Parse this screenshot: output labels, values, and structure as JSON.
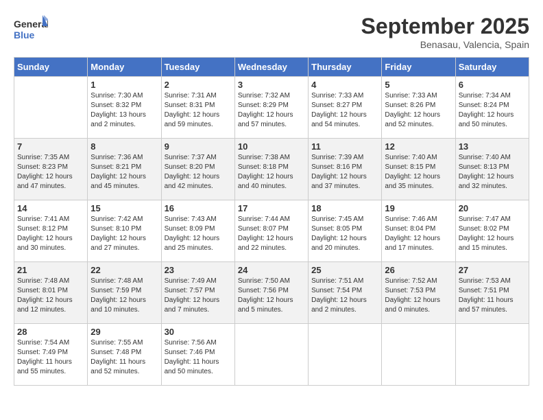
{
  "logo": {
    "text_general": "General",
    "text_blue": "Blue"
  },
  "header": {
    "month": "September 2025",
    "location": "Benasau, Valencia, Spain"
  },
  "weekdays": [
    "Sunday",
    "Monday",
    "Tuesday",
    "Wednesday",
    "Thursday",
    "Friday",
    "Saturday"
  ],
  "weeks": [
    [
      {
        "day": "",
        "info": ""
      },
      {
        "day": "1",
        "info": "Sunrise: 7:30 AM\nSunset: 8:32 PM\nDaylight: 13 hours\nand 2 minutes."
      },
      {
        "day": "2",
        "info": "Sunrise: 7:31 AM\nSunset: 8:31 PM\nDaylight: 12 hours\nand 59 minutes."
      },
      {
        "day": "3",
        "info": "Sunrise: 7:32 AM\nSunset: 8:29 PM\nDaylight: 12 hours\nand 57 minutes."
      },
      {
        "day": "4",
        "info": "Sunrise: 7:33 AM\nSunset: 8:27 PM\nDaylight: 12 hours\nand 54 minutes."
      },
      {
        "day": "5",
        "info": "Sunrise: 7:33 AM\nSunset: 8:26 PM\nDaylight: 12 hours\nand 52 minutes."
      },
      {
        "day": "6",
        "info": "Sunrise: 7:34 AM\nSunset: 8:24 PM\nDaylight: 12 hours\nand 50 minutes."
      }
    ],
    [
      {
        "day": "7",
        "info": "Sunrise: 7:35 AM\nSunset: 8:23 PM\nDaylight: 12 hours\nand 47 minutes."
      },
      {
        "day": "8",
        "info": "Sunrise: 7:36 AM\nSunset: 8:21 PM\nDaylight: 12 hours\nand 45 minutes."
      },
      {
        "day": "9",
        "info": "Sunrise: 7:37 AM\nSunset: 8:20 PM\nDaylight: 12 hours\nand 42 minutes."
      },
      {
        "day": "10",
        "info": "Sunrise: 7:38 AM\nSunset: 8:18 PM\nDaylight: 12 hours\nand 40 minutes."
      },
      {
        "day": "11",
        "info": "Sunrise: 7:39 AM\nSunset: 8:16 PM\nDaylight: 12 hours\nand 37 minutes."
      },
      {
        "day": "12",
        "info": "Sunrise: 7:40 AM\nSunset: 8:15 PM\nDaylight: 12 hours\nand 35 minutes."
      },
      {
        "day": "13",
        "info": "Sunrise: 7:40 AM\nSunset: 8:13 PM\nDaylight: 12 hours\nand 32 minutes."
      }
    ],
    [
      {
        "day": "14",
        "info": "Sunrise: 7:41 AM\nSunset: 8:12 PM\nDaylight: 12 hours\nand 30 minutes."
      },
      {
        "day": "15",
        "info": "Sunrise: 7:42 AM\nSunset: 8:10 PM\nDaylight: 12 hours\nand 27 minutes."
      },
      {
        "day": "16",
        "info": "Sunrise: 7:43 AM\nSunset: 8:09 PM\nDaylight: 12 hours\nand 25 minutes."
      },
      {
        "day": "17",
        "info": "Sunrise: 7:44 AM\nSunset: 8:07 PM\nDaylight: 12 hours\nand 22 minutes."
      },
      {
        "day": "18",
        "info": "Sunrise: 7:45 AM\nSunset: 8:05 PM\nDaylight: 12 hours\nand 20 minutes."
      },
      {
        "day": "19",
        "info": "Sunrise: 7:46 AM\nSunset: 8:04 PM\nDaylight: 12 hours\nand 17 minutes."
      },
      {
        "day": "20",
        "info": "Sunrise: 7:47 AM\nSunset: 8:02 PM\nDaylight: 12 hours\nand 15 minutes."
      }
    ],
    [
      {
        "day": "21",
        "info": "Sunrise: 7:48 AM\nSunset: 8:01 PM\nDaylight: 12 hours\nand 12 minutes."
      },
      {
        "day": "22",
        "info": "Sunrise: 7:48 AM\nSunset: 7:59 PM\nDaylight: 12 hours\nand 10 minutes."
      },
      {
        "day": "23",
        "info": "Sunrise: 7:49 AM\nSunset: 7:57 PM\nDaylight: 12 hours\nand 7 minutes."
      },
      {
        "day": "24",
        "info": "Sunrise: 7:50 AM\nSunset: 7:56 PM\nDaylight: 12 hours\nand 5 minutes."
      },
      {
        "day": "25",
        "info": "Sunrise: 7:51 AM\nSunset: 7:54 PM\nDaylight: 12 hours\nand 2 minutes."
      },
      {
        "day": "26",
        "info": "Sunrise: 7:52 AM\nSunset: 7:53 PM\nDaylight: 12 hours\nand 0 minutes."
      },
      {
        "day": "27",
        "info": "Sunrise: 7:53 AM\nSunset: 7:51 PM\nDaylight: 11 hours\nand 57 minutes."
      }
    ],
    [
      {
        "day": "28",
        "info": "Sunrise: 7:54 AM\nSunset: 7:49 PM\nDaylight: 11 hours\nand 55 minutes."
      },
      {
        "day": "29",
        "info": "Sunrise: 7:55 AM\nSunset: 7:48 PM\nDaylight: 11 hours\nand 52 minutes."
      },
      {
        "day": "30",
        "info": "Sunrise: 7:56 AM\nSunset: 7:46 PM\nDaylight: 11 hours\nand 50 minutes."
      },
      {
        "day": "",
        "info": ""
      },
      {
        "day": "",
        "info": ""
      },
      {
        "day": "",
        "info": ""
      },
      {
        "day": "",
        "info": ""
      }
    ]
  ]
}
